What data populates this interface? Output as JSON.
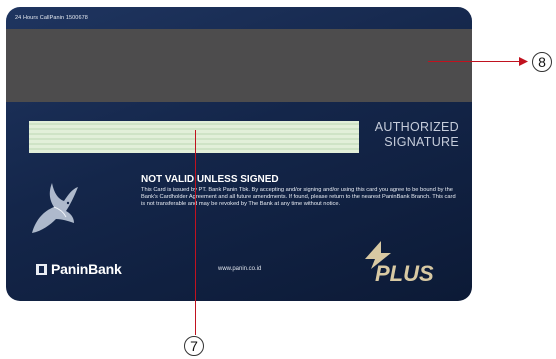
{
  "card": {
    "hotline": "24 Hours CallPanin 1500678",
    "authorized_line1": "AUTHORIZED",
    "authorized_line2": "SIGNATURE",
    "not_valid": "NOT VALID UNLESS SIGNED",
    "terms": "This Card is issued by PT. Bank Panin Tbk. By accepting and/or signing and/or using this card you agree to be bound by the Bank's Cardholder Agreement and all future amendments. If found, please return to the nearest PaninBank Branch. This card is not transferable and may be revoked by The Bank at any time without notice.",
    "bank_name": "PaninBank",
    "website": "www.panin.co.id",
    "network": "PLUS"
  },
  "callouts": {
    "signature_panel": "7",
    "magnetic_stripe": "8"
  },
  "colors": {
    "card_bg": "#14264a",
    "stripe": "#4d4c4d",
    "callout_line": "#c1121f",
    "plus_gold": "#d8c9a3"
  }
}
